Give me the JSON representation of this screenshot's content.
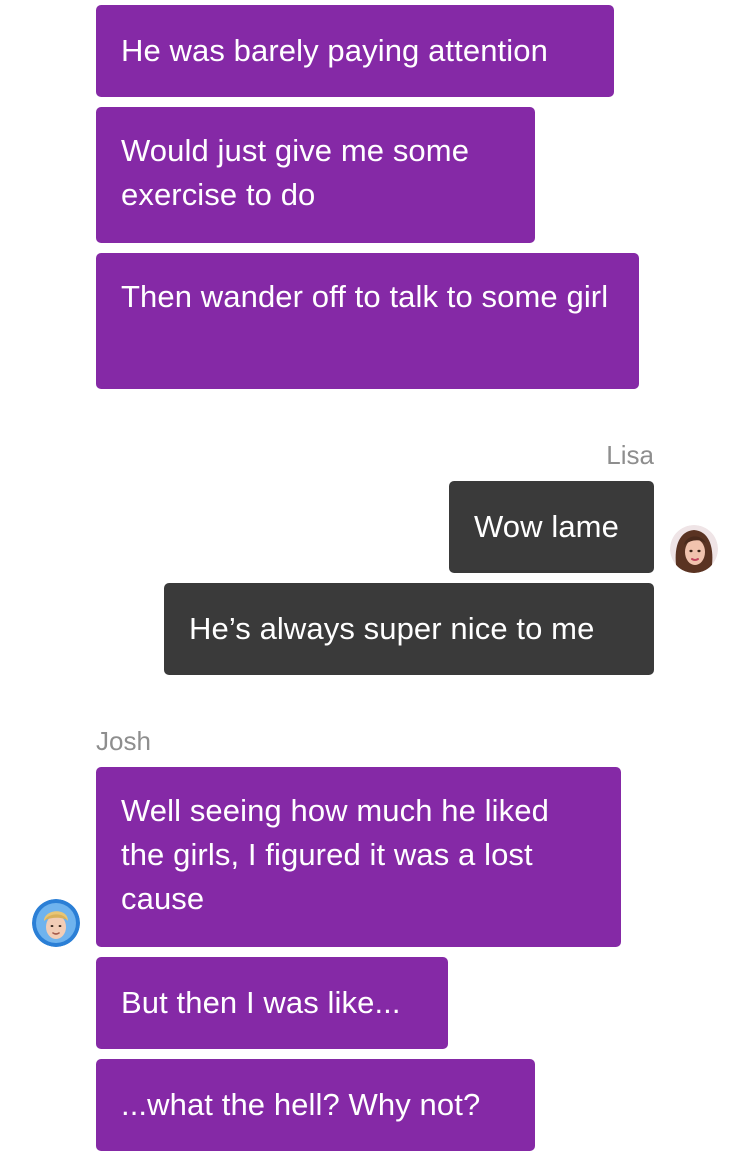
{
  "chat": {
    "group1": {
      "messages": [
        "He was barely paying attention",
        "Would just give me some exercise to do",
        "Then wander off to talk to some girl"
      ]
    },
    "lisa": {
      "name": "Lisa",
      "avatar_icon": "female-avatar-icon",
      "messages": [
        "Wow lame",
        "He’s always super nice to me"
      ]
    },
    "josh": {
      "name": "Josh",
      "avatar_icon": "male-avatar-icon",
      "messages": [
        "Well seeing how much he liked the girls, I figured it was a lost cause",
        "But then I was like...",
        "...what the hell? Why not?"
      ]
    }
  },
  "colors": {
    "incoming_bubble": "#8529a6",
    "outgoing_bubble": "#3a3a3a",
    "sender_label": "#8e8e8e",
    "background": "#ffffff"
  }
}
